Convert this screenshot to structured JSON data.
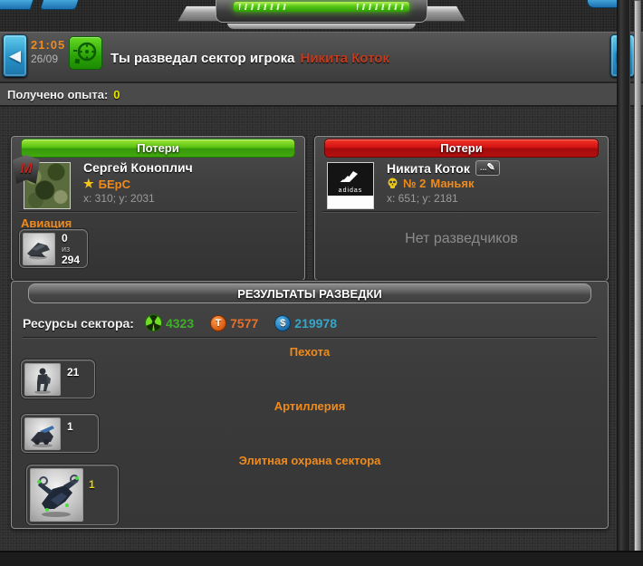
{
  "colors": {
    "accent_orange": "#ef8b1d",
    "link_red": "#c23b1e",
    "xp_yellow": "#e8e400",
    "uranium_green": "#3fae2a",
    "titanite_orange": "#e8702a",
    "credits_blue": "#35a6c9",
    "header_green": "#58c314",
    "header_red": "#d31313",
    "nav_blue": "#2e98cc"
  },
  "icons": {
    "prev_arrow": "◀",
    "next_arrow": "▶",
    "star": "★",
    "pencil": "✎",
    "edit_dots": "...",
    "titanite_letter": "T",
    "credits_letter": "$",
    "clan_letter": "M"
  },
  "banner": {
    "time": "21:05",
    "date": "26/09",
    "message": "Ты разведал сектор игрока",
    "player": "Никита Коток"
  },
  "xp": {
    "label": "Получено опыта:",
    "value": "0"
  },
  "attacker": {
    "header": "Потери",
    "name": "Сергей Коноплич",
    "clan": "БЕрС",
    "coords": "x: 310; y: 2031",
    "section": "Авиация",
    "unit": {
      "count": "0",
      "of": "из",
      "total": "294"
    }
  },
  "defender": {
    "header": "Потери",
    "name": "Никита Коток",
    "rank_number": "№ 2",
    "rank_title": "Маньяк",
    "avatar_word": "adidas",
    "coords": "x: 651; y: 2181",
    "empty": "Нет разведчиков"
  },
  "results": {
    "title": "РЕЗУЛЬТАТЫ РАЗВЕДКИ",
    "resources_label": "Ресурсы сектора:",
    "resources": [
      {
        "name": "uranium",
        "value": "4323"
      },
      {
        "name": "titanite",
        "value": "7577"
      },
      {
        "name": "credits",
        "value": "219978"
      }
    ],
    "sections": [
      {
        "title": "Пехота",
        "count": "21"
      },
      {
        "title": "Артиллерия",
        "count": "1"
      },
      {
        "title": "Элитная охрана сектора",
        "count": "1"
      }
    ]
  }
}
